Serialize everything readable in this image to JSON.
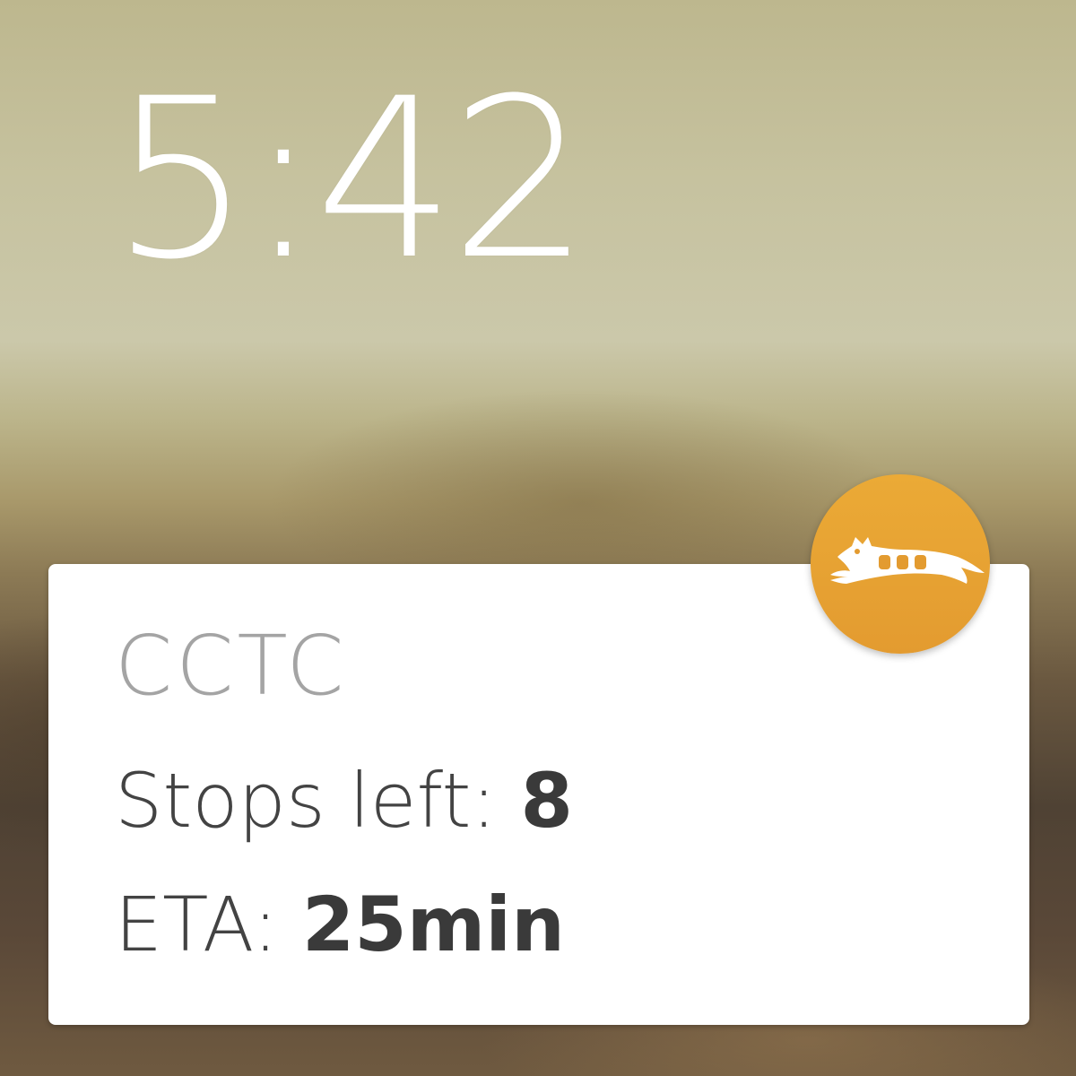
{
  "clock": {
    "time": "5:42"
  },
  "notification": {
    "app_icon": "cat-bus-icon",
    "title": "CCTC",
    "stops_label": "Stops left:",
    "stops_value": "8",
    "eta_label": "ETA:",
    "eta_value": "25min"
  },
  "colors": {
    "badge": "#e8a534",
    "card_background": "#ffffff",
    "title_text": "#a4a4a4",
    "body_text": "#434343"
  }
}
